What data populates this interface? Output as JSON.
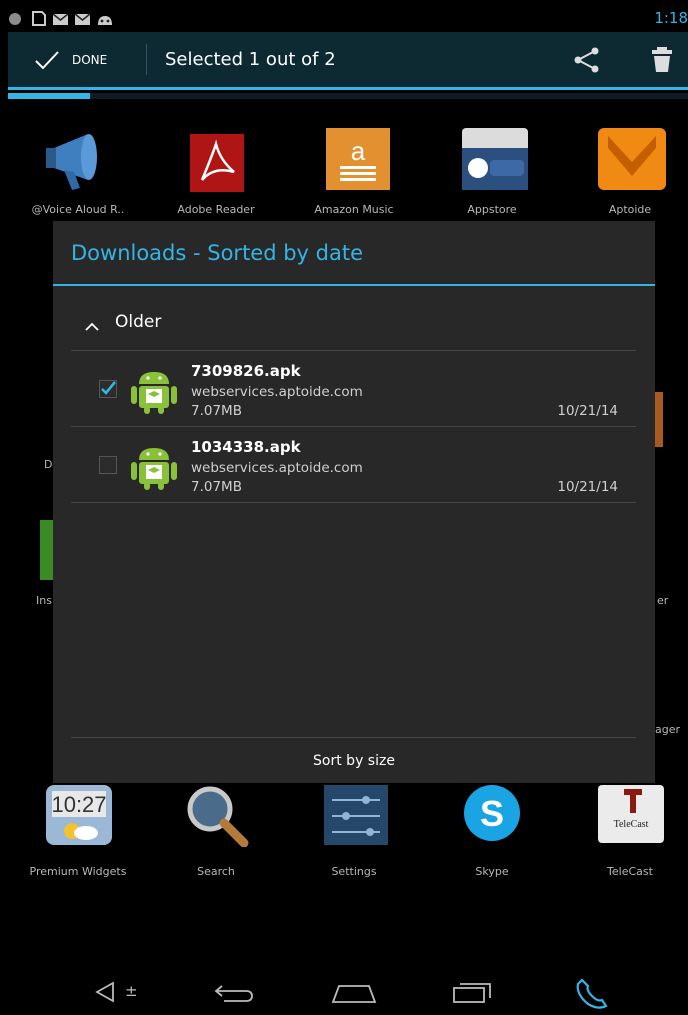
{
  "status_bar": {
    "clock": "1:18",
    "icons": [
      "circle-icon",
      "notification-icon",
      "mail-icon",
      "mail-icon",
      "android-icon"
    ]
  },
  "action_bar": {
    "done_label": "DONE",
    "title": "Selected 1 out of 2",
    "icons": [
      "check-icon",
      "share-icon",
      "trash-icon"
    ],
    "accent_color": "#33b5e5"
  },
  "launcher": {
    "row1": [
      {
        "label": "@Voice Aloud R..",
        "icon": "megaphone-icon"
      },
      {
        "label": "Adobe Reader",
        "icon": "adobe-reader-icon"
      },
      {
        "label": "Amazon Music",
        "icon": "amazon-music-icon"
      },
      {
        "label": "Appstore",
        "icon": "amazon-appstore-icon"
      },
      {
        "label": "Aptoide",
        "icon": "aptoide-icon"
      }
    ],
    "row4": [
      {
        "label": "Premium Widgets",
        "icon": "clock-widget-icon"
      },
      {
        "label": "Search",
        "icon": "magnifier-icon"
      },
      {
        "label": "Settings",
        "icon": "settings-sliders-icon"
      },
      {
        "label": "Skype",
        "icon": "skype-icon"
      },
      {
        "label": "TeleCast",
        "icon": "telecast-icon"
      }
    ],
    "partial_labels": [
      "D",
      "Ins",
      "er",
      "ager"
    ]
  },
  "dialog": {
    "title": "Downloads - Sorted by date",
    "group_label": "Older",
    "downloads": [
      {
        "name": "7309826.apk",
        "host": "webservices.aptoide.com",
        "size": "7.07MB",
        "date": "10/21/14",
        "checked": true
      },
      {
        "name": "1034338.apk",
        "host": "webservices.aptoide.com",
        "size": "7.07MB",
        "date": "10/21/14",
        "checked": false
      }
    ],
    "sort_button": "Sort by size"
  },
  "telecast_logo_text": "TeleCast",
  "nav_bar": {
    "icons": [
      "volume-icon",
      "back-icon",
      "home-icon",
      "recents-icon",
      "phone-icon"
    ]
  }
}
